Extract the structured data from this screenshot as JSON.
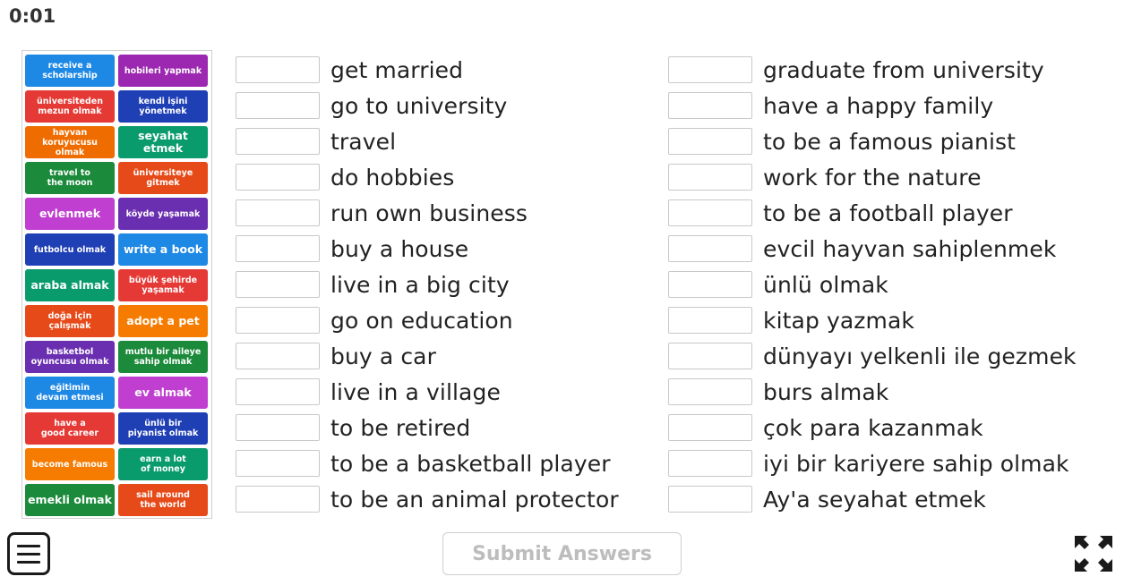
{
  "timer": "0:01",
  "tiles": [
    {
      "label": "receive a\nscholarship",
      "color": "#1e88e5",
      "size": "small"
    },
    {
      "label": "hobileri yapmak",
      "color": "#9c27b0",
      "size": "small"
    },
    {
      "label": "üniversiteden\nmezun olmak",
      "color": "#e53935",
      "size": "small"
    },
    {
      "label": "kendi işini\nyönetmek",
      "color": "#1f3fb5",
      "size": "small"
    },
    {
      "label": "hayvan\nkoruyucusu olmak",
      "color": "#ef6c00",
      "size": "small"
    },
    {
      "label": "seyahat etmek",
      "color": "#0a9b6c",
      "size": "big"
    },
    {
      "label": "travel to\nthe moon",
      "color": "#1b8a3a",
      "size": "small"
    },
    {
      "label": "üniversiteye\ngitmek",
      "color": "#e64a19",
      "size": "small"
    },
    {
      "label": "evlenmek",
      "color": "#c03fd1",
      "size": "big"
    },
    {
      "label": "köyde yaşamak",
      "color": "#6a2fb0",
      "size": "small"
    },
    {
      "label": "futbolcu olmak",
      "color": "#1f3fb5",
      "size": "small"
    },
    {
      "label": "write a book",
      "color": "#1e88e5",
      "size": "big"
    },
    {
      "label": "araba almak",
      "color": "#0a9b6c",
      "size": "big"
    },
    {
      "label": "büyük şehirde\nyaşamak",
      "color": "#e53935",
      "size": "small"
    },
    {
      "label": "doğa için\nçalışmak",
      "color": "#e64a19",
      "size": "small"
    },
    {
      "label": "adopt a pet",
      "color": "#f57c00",
      "size": "big"
    },
    {
      "label": "basketbol\noyuncusu olmak",
      "color": "#6a2fb0",
      "size": "small"
    },
    {
      "label": "mutlu bir aileye\nsahip olmak",
      "color": "#1b8a3a",
      "size": "small"
    },
    {
      "label": "eğitimin\ndevam etmesi",
      "color": "#1e88e5",
      "size": "small"
    },
    {
      "label": "ev almak",
      "color": "#c03fd1",
      "size": "big"
    },
    {
      "label": "have a\ngood career",
      "color": "#e53935",
      "size": "small"
    },
    {
      "label": "ünlü bir\npiyanist olmak",
      "color": "#1f3fb5",
      "size": "small"
    },
    {
      "label": "become famous",
      "color": "#f57c00",
      "size": "small"
    },
    {
      "label": "earn a lot\nof money",
      "color": "#0a9b6c",
      "size": "small"
    },
    {
      "label": "emekli olmak",
      "color": "#1b8a3a",
      "size": "big"
    },
    {
      "label": "sail around\nthe world",
      "color": "#e64a19",
      "size": "small"
    }
  ],
  "left_items": [
    "get married",
    "go to university",
    "travel",
    "do hobbies",
    "run own business",
    "buy a house",
    "live in a big city",
    "go on education",
    "buy a car",
    "live in a village",
    "to be retired",
    "to be a basketball player",
    "to be an animal protector"
  ],
  "right_items": [
    "graduate from university",
    "have a happy family",
    "to be a famous pianist",
    "work for the nature",
    "to be a football player",
    "evcil hayvan sahiplenmek",
    "ünlü olmak",
    "kitap yazmak",
    "dünyayı yelkenli ile gezmek",
    "burs almak",
    "çok para kazanmak",
    "iyi bir kariyere sahip olmak",
    "Ay'a seyahat etmek"
  ],
  "submit_label": "Submit Answers",
  "icons": {
    "menu": "menu-icon",
    "fullscreen": "fullscreen-icon"
  }
}
